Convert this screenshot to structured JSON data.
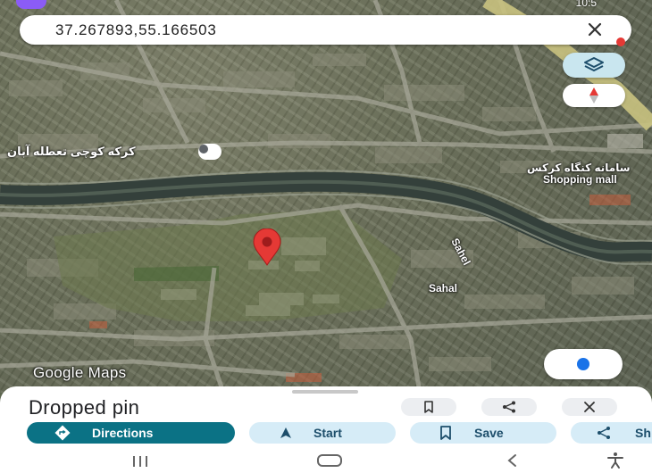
{
  "status_bar": {
    "time": "10:5"
  },
  "search": {
    "query": "37.267893,55.166503"
  },
  "map": {
    "labels": [
      {
        "id": "label-mosque",
        "text": "کرکه کوچی تعطله آبان"
      },
      {
        "id": "label-shopping-persian",
        "text": "سامانه کنگاه کرکس"
      },
      {
        "id": "label-shopping-mall",
        "text": "Shopping mall"
      },
      {
        "id": "label-sahel-1",
        "text": "Sahel"
      },
      {
        "id": "label-sahel-2",
        "text": "Sahal"
      }
    ],
    "watermark": "Google Maps",
    "pin_color": "#e53935",
    "locate_dot_color": "#1a73e8"
  },
  "sheet": {
    "title": "Dropped pin",
    "actions": {
      "directions": "Directions",
      "start": "Start",
      "save": "Save",
      "share": "Sh"
    },
    "colors": {
      "primary_chip": "#0b7285",
      "secondary_chip": "#d6ecf7"
    }
  },
  "icons": {
    "close": "close-icon",
    "layers": "layers-icon",
    "compass": "compass-icon",
    "my_location": "my-location-icon",
    "bookmark": "bookmark-icon",
    "share": "share-icon",
    "directions": "directions-icon",
    "navigation": "navigation-arrow-icon",
    "recents": "recents-icon",
    "home": "home-icon",
    "back": "back-icon",
    "accessibility": "accessibility-icon"
  }
}
